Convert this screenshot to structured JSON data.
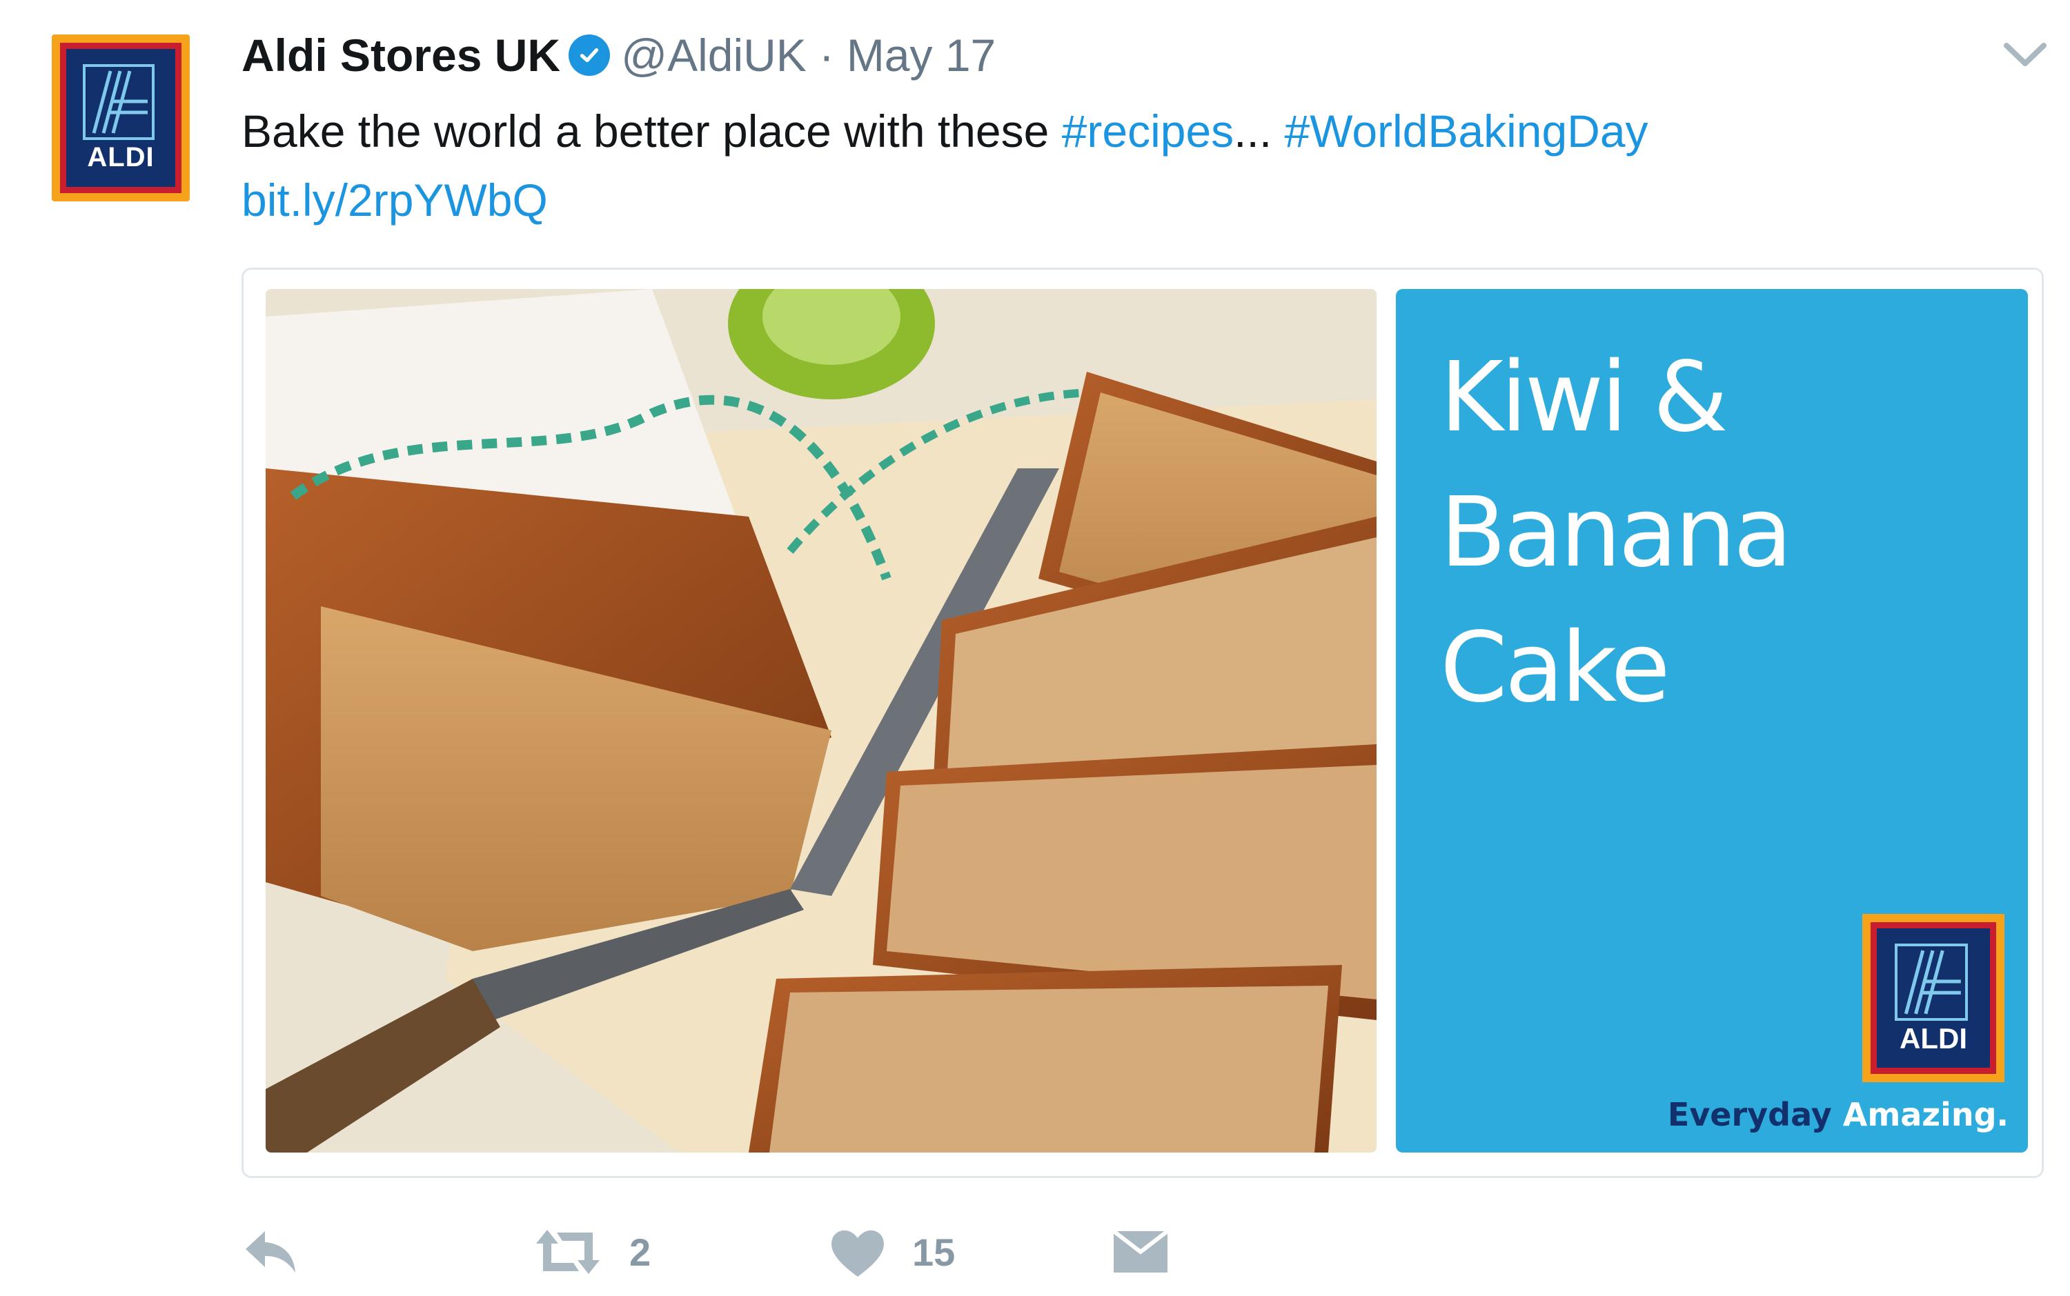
{
  "tweet": {
    "author_name": "Aldi Stores UK",
    "handle": "@AldiUK",
    "separator": "·",
    "date": "May 17",
    "text_plain": "Bake the world a better place with these ",
    "hashtag_recipes": "#recipes",
    "ellipsis": "...",
    "hashtag_baking": "#WorldBakingDay",
    "link": "bit.ly/2rpYWbQ"
  },
  "avatar": {
    "logo_text": "ALDI"
  },
  "card": {
    "title_line1": "Kiwi & Banana",
    "title_line2": "Cake",
    "logo_text": "ALDI",
    "tagline_part1": "Everyday",
    "tagline_part2": "Amazing."
  },
  "actions": {
    "reply_icon": "reply-icon",
    "retweet_icon": "retweet-icon",
    "retweet_count": "2",
    "like_icon": "heart-icon",
    "like_count": "15",
    "dm_icon": "envelope-icon"
  },
  "colors": {
    "link": "#1b95e0",
    "verified": "#1b95e0",
    "panel_blue": "#2dabdc",
    "aldi_navy": "#12306b",
    "aldi_orange": "#f7a21b",
    "aldi_red": "#c81e2f"
  }
}
